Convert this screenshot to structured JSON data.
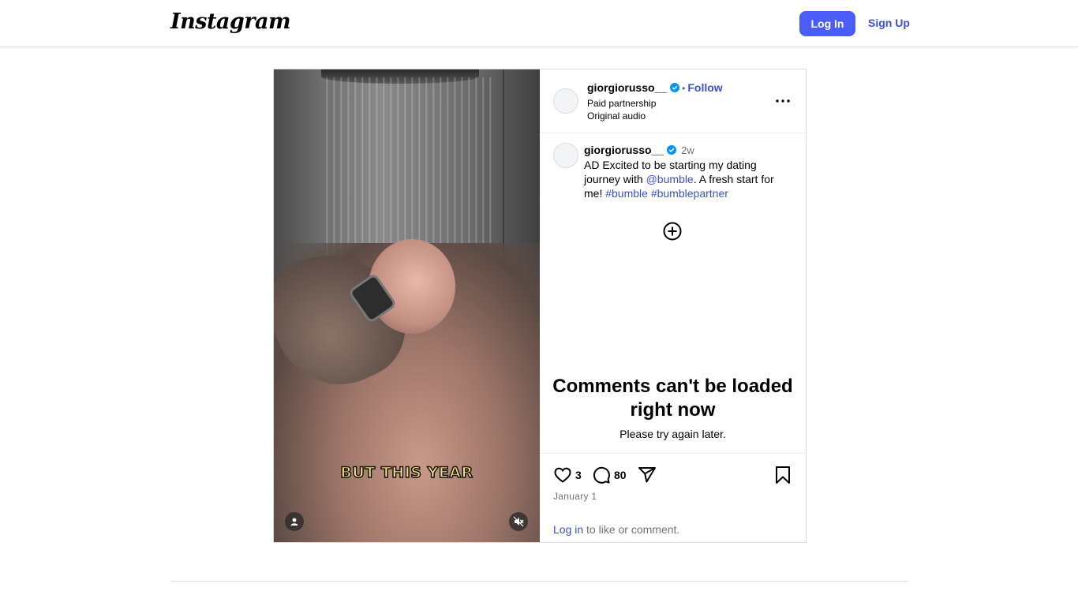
{
  "app": {
    "logo_text": "Instagram"
  },
  "topbar": {
    "login_label": "Log In",
    "signup_label": "Sign Up"
  },
  "post": {
    "media": {
      "caption_overlay": "BUT THIS YEAR",
      "user_icon": "user-icon",
      "mute_icon": "mute-icon"
    },
    "header": {
      "username": "giorgiorusso__",
      "follow_label": "Follow",
      "separator": "•",
      "subtitle_1": "Paid partnership",
      "subtitle_2": "Original audio"
    },
    "caption": {
      "username": "giorgiorusso__",
      "time": "2w",
      "text_before": "AD Excited to be starting my dating journey with ",
      "mention": "@bumble",
      "text_after": ". A fresh start for me! ",
      "hashtag_1": "#bumble",
      "hashtag_2": "#bumblepartner"
    },
    "error": {
      "title": "Comments can't be loaded right now",
      "subtitle": "Please try again later."
    },
    "actions": {
      "like_count": "3",
      "comment_count": "80",
      "date": "January 1",
      "login_link": "Log in",
      "login_suffix": " to like or comment."
    }
  },
  "colors": {
    "accent": "#4a5df9",
    "link": "#3a4fd8",
    "verified": "#0095f6",
    "muted": "#737373"
  }
}
